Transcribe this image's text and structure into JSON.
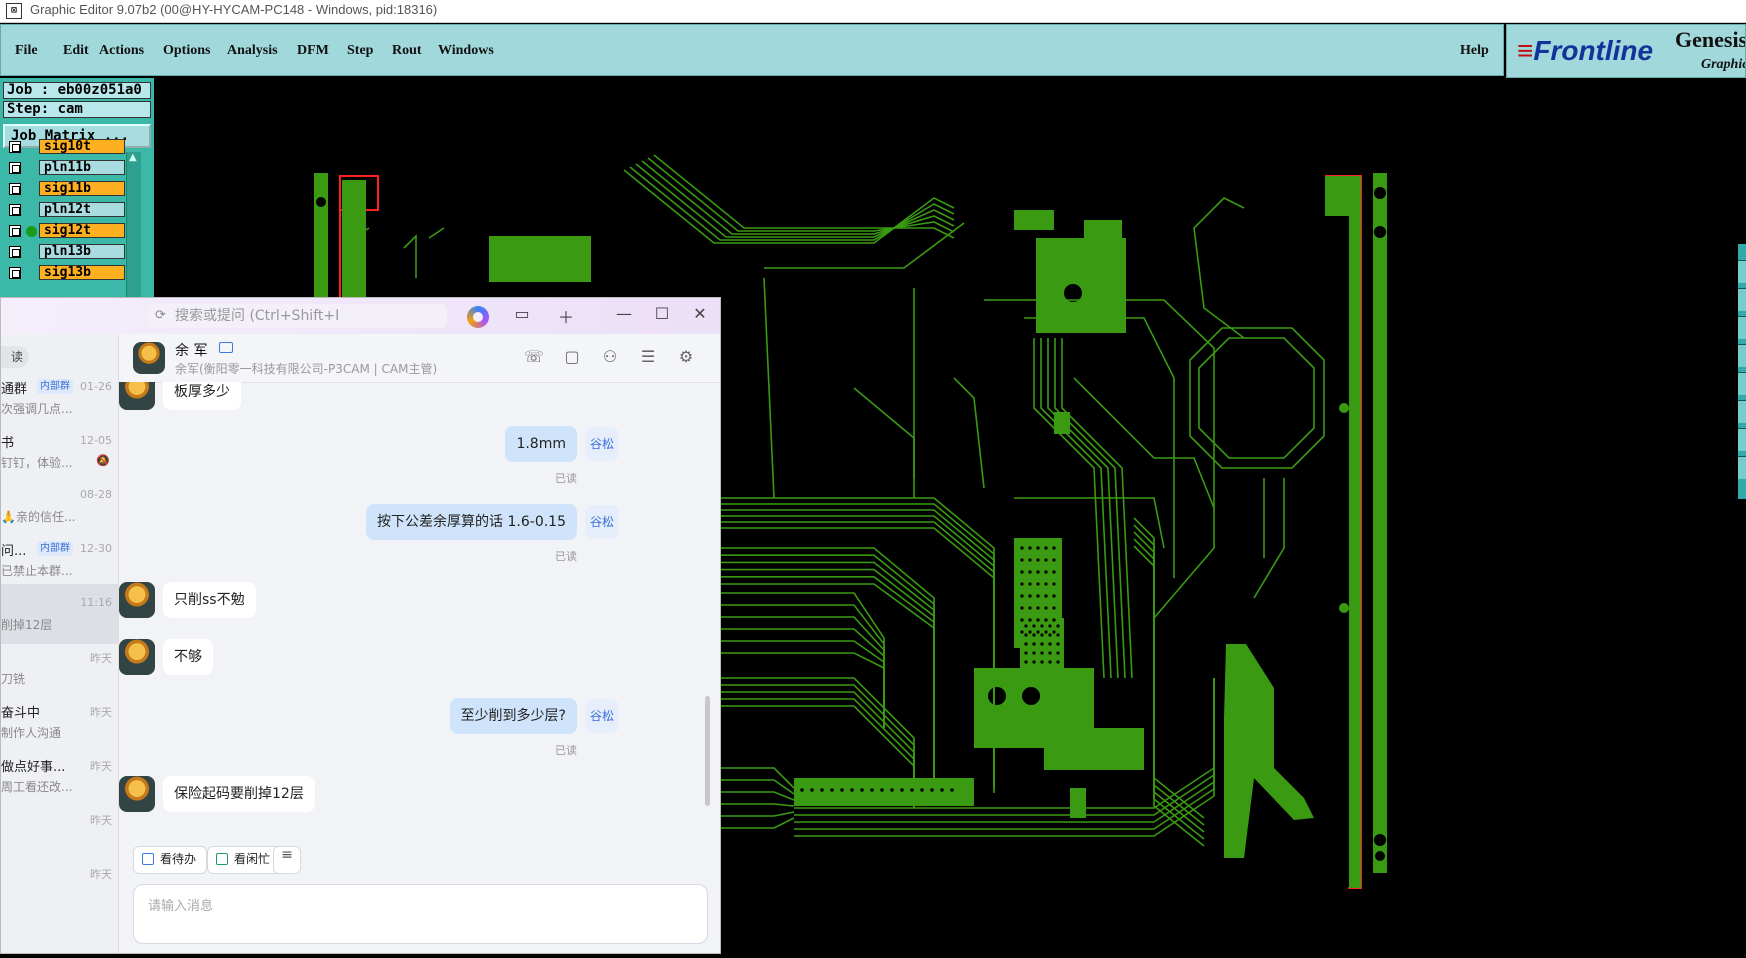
{
  "window": {
    "title": "Graphic Editor 9.07b2 (00@HY-HYCAM-PC148 - Windows, pid:18316)"
  },
  "menu": {
    "items": [
      "File",
      "Edit",
      "Actions",
      "Options",
      "Analysis",
      "DFM",
      "Step",
      "Rout",
      "Windows"
    ],
    "help": "Help"
  },
  "brand": {
    "logo": "Frontline",
    "product": "Genesis",
    "subtitle": "Graphic"
  },
  "job": {
    "job_label": "Job : eb00z051a0",
    "step_label": "Step: cam",
    "matrix_button": "Job Matrix ...",
    "layers": [
      {
        "name": "sig10t",
        "kind": "sig",
        "active": false
      },
      {
        "name": "pln11b",
        "kind": "pln",
        "active": false
      },
      {
        "name": "sig11b",
        "kind": "sig",
        "active": false
      },
      {
        "name": "pln12t",
        "kind": "pln",
        "active": false
      },
      {
        "name": "sig12t",
        "kind": "sig",
        "active": true
      },
      {
        "name": "pln13b",
        "kind": "pln",
        "active": false
      },
      {
        "name": "sig13b",
        "kind": "sig",
        "active": false
      }
    ]
  },
  "colors": {
    "trace": "#3a9a12",
    "board_outline": "#ff2020",
    "menu_bg": "#a0d8dc",
    "sig_layer": "#ffb020",
    "pln_layer": "#a8dce0"
  },
  "chat": {
    "search_placeholder": "搜索或提问 (Ctrl+Shift+I",
    "filter_label": "读",
    "conversations": [
      {
        "name": "通群",
        "tag": "内部群",
        "time": "01-26",
        "preview": "次强调几点...",
        "muted": false,
        "selected": false
      },
      {
        "name": "书",
        "tag": "",
        "time": "12-05",
        "preview": "钉钉，体验...",
        "muted": true,
        "selected": false
      },
      {
        "name": "",
        "tag": "",
        "time": "08-28",
        "preview": "🙏亲的信任...",
        "muted": false,
        "selected": false
      },
      {
        "name": "问...",
        "tag": "内部群",
        "time": "12-30",
        "preview": "已禁止本群...",
        "muted": false,
        "selected": false
      },
      {
        "name": "",
        "tag": "",
        "time": "11:16",
        "preview": "削掉12层",
        "muted": false,
        "selected": true
      },
      {
        "name": "",
        "tag": "",
        "time": "昨天",
        "preview": "刀铣",
        "muted": false,
        "selected": false
      },
      {
        "name": "奋斗中",
        "tag": "",
        "time": "昨天",
        "preview": "制作人沟通",
        "muted": false,
        "selected": false
      },
      {
        "name": "做点好事...",
        "tag": "",
        "time": "昨天",
        "preview": "周工看还改...",
        "muted": false,
        "selected": false
      },
      {
        "name": "",
        "tag": "",
        "time": "昨天",
        "preview": "",
        "muted": false,
        "selected": false
      },
      {
        "name": "",
        "tag": "",
        "time": "昨天",
        "preview": "",
        "muted": false,
        "selected": false
      }
    ],
    "contact": {
      "name": "余 军",
      "subtitle": "余军(衡阳零一科技有限公司-P3CAM | CAM主管)"
    },
    "messages": [
      {
        "dir": "in",
        "text": "板厚多少"
      },
      {
        "dir": "out",
        "text": "1.8mm",
        "sender": "谷松",
        "status": "已读"
      },
      {
        "dir": "out",
        "text": "按下公差余厚算的话 1.6-0.15",
        "sender": "谷松",
        "status": "已读"
      },
      {
        "dir": "in",
        "text": "只削ss不勉"
      },
      {
        "dir": "in",
        "text": "不够"
      },
      {
        "dir": "out",
        "text": "至少削到多少层?",
        "sender": "谷松",
        "status": "已读"
      },
      {
        "dir": "in",
        "text": "保险起码要削掉12层"
      }
    ],
    "quick_actions": [
      "看待办",
      "看闲忙"
    ],
    "input_placeholder": "请输入消息"
  }
}
